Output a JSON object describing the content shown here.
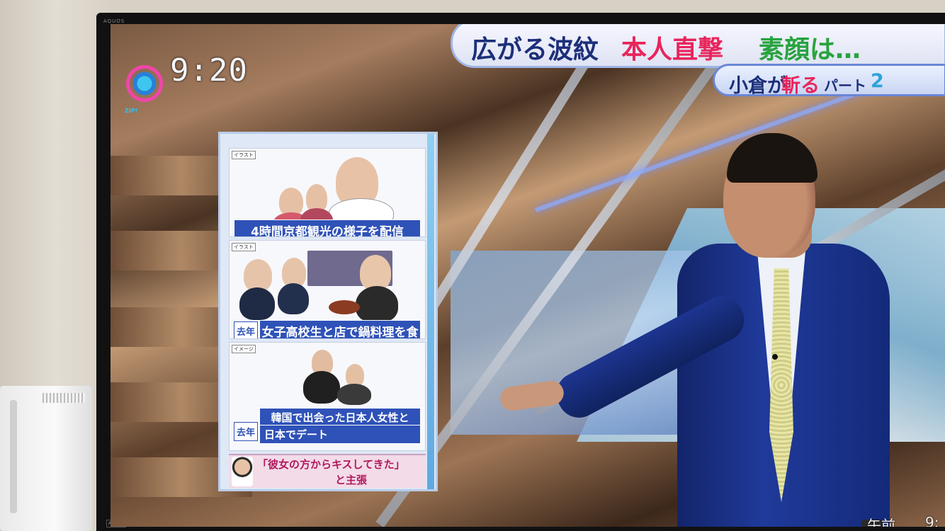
{
  "tv": {
    "brand_top": "AQUOS",
    "brand_bottom": "AQUOS"
  },
  "broadcast": {
    "clock": "9:20",
    "logo_sub": "ZIP!",
    "headline": {
      "part1": "広がる波紋",
      "part2": "本人直撃",
      "part3": "素顔は…"
    },
    "subheadline": {
      "part1": "小倉が",
      "part2": "斬る",
      "part3": "パート",
      "part4": "2"
    },
    "bottom_time_label": "午前",
    "bottom_time_value": "9:"
  },
  "board": {
    "panels": [
      {
        "tag": "イラスト",
        "caption": "4時間京都観光の様子を配信",
        "year": ""
      },
      {
        "tag": "イラスト",
        "caption": "女子高校生と店で鍋料理を食べる",
        "year": "去年"
      },
      {
        "tag": "イメージ",
        "caption_line1": "韓国で出会った日本人女性と",
        "caption_line2": "日本でデート",
        "year": "去年"
      }
    ],
    "quote_line1": "「彼女の方からキスしてきた」",
    "quote_line2": "と主張"
  }
}
